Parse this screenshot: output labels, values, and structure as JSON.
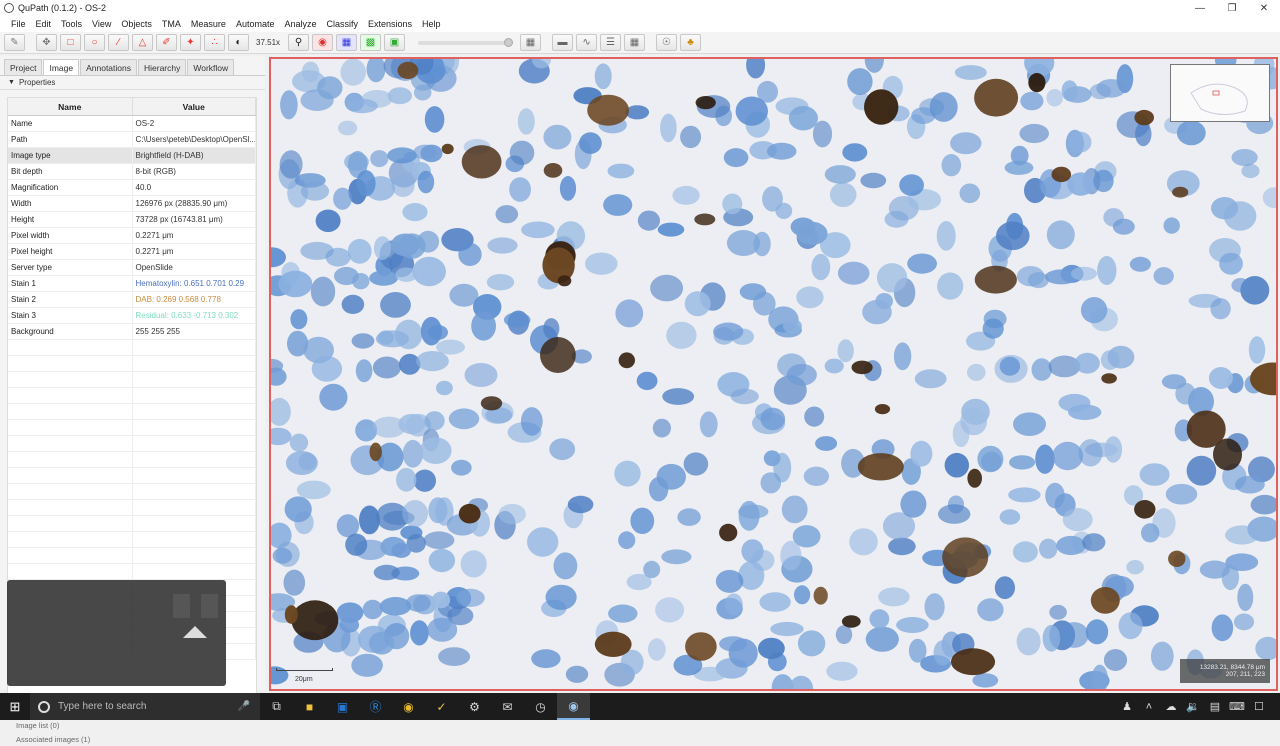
{
  "window": {
    "title": "QuPath (0.1.2) - OS-2",
    "minimize": "—",
    "maximize": "❐",
    "close": "✕"
  },
  "menu": [
    "File",
    "Edit",
    "Tools",
    "View",
    "Objects",
    "TMA",
    "Measure",
    "Automate",
    "Analyze",
    "Classify",
    "Extensions",
    "Help"
  ],
  "toolbar": {
    "zoom": "37.51x"
  },
  "tabs": [
    "Project",
    "Image",
    "Annotations",
    "Hierarchy",
    "Workflow"
  ],
  "active_tab": "Image",
  "properties_header": "Properties",
  "table": {
    "col_name": "Name",
    "col_value": "Value",
    "rows": [
      {
        "name": "Name",
        "value": "OS-2"
      },
      {
        "name": "Path",
        "value": "C:\\Users\\peteb\\Desktop\\OpenSl..."
      },
      {
        "name": "Image type",
        "value": "Brightfield (H-DAB)"
      },
      {
        "name": "Bit depth",
        "value": "8-bit (RGB)"
      },
      {
        "name": "Magnification",
        "value": "40.0"
      },
      {
        "name": "Width",
        "value": "126976 px (28835.90 μm)"
      },
      {
        "name": "Height",
        "value": "73728 px (16743.81 μm)"
      },
      {
        "name": "Pixel width",
        "value": "0.2271 μm"
      },
      {
        "name": "Pixel height",
        "value": "0.2271 μm"
      },
      {
        "name": "Server type",
        "value": "OpenSlide"
      },
      {
        "name": "Stain 1",
        "value": "Hematoxylin: 0.651 0.701 0.29"
      },
      {
        "name": "Stain 2",
        "value": "DAB: 0.269 0.568 0.778"
      },
      {
        "name": "Stain 3",
        "value": "Residual: 0.633 -0.713 0.302"
      },
      {
        "name": "Background",
        "value": "255 255 255"
      }
    ],
    "stain_colors": {
      "stain1": "#4a6fc2",
      "stain2": "#c98a3d",
      "stain3": "#7fdcc0"
    }
  },
  "bottom_tabs": [
    "Image list (0)",
    "Associated images (1)"
  ],
  "viewer": {
    "scalebar": "20μm",
    "coords_line1": "13283.21, 8344.78 μm",
    "coords_line2": "207, 211, 223"
  },
  "taskbar": {
    "search_placeholder": "Type here to search"
  }
}
